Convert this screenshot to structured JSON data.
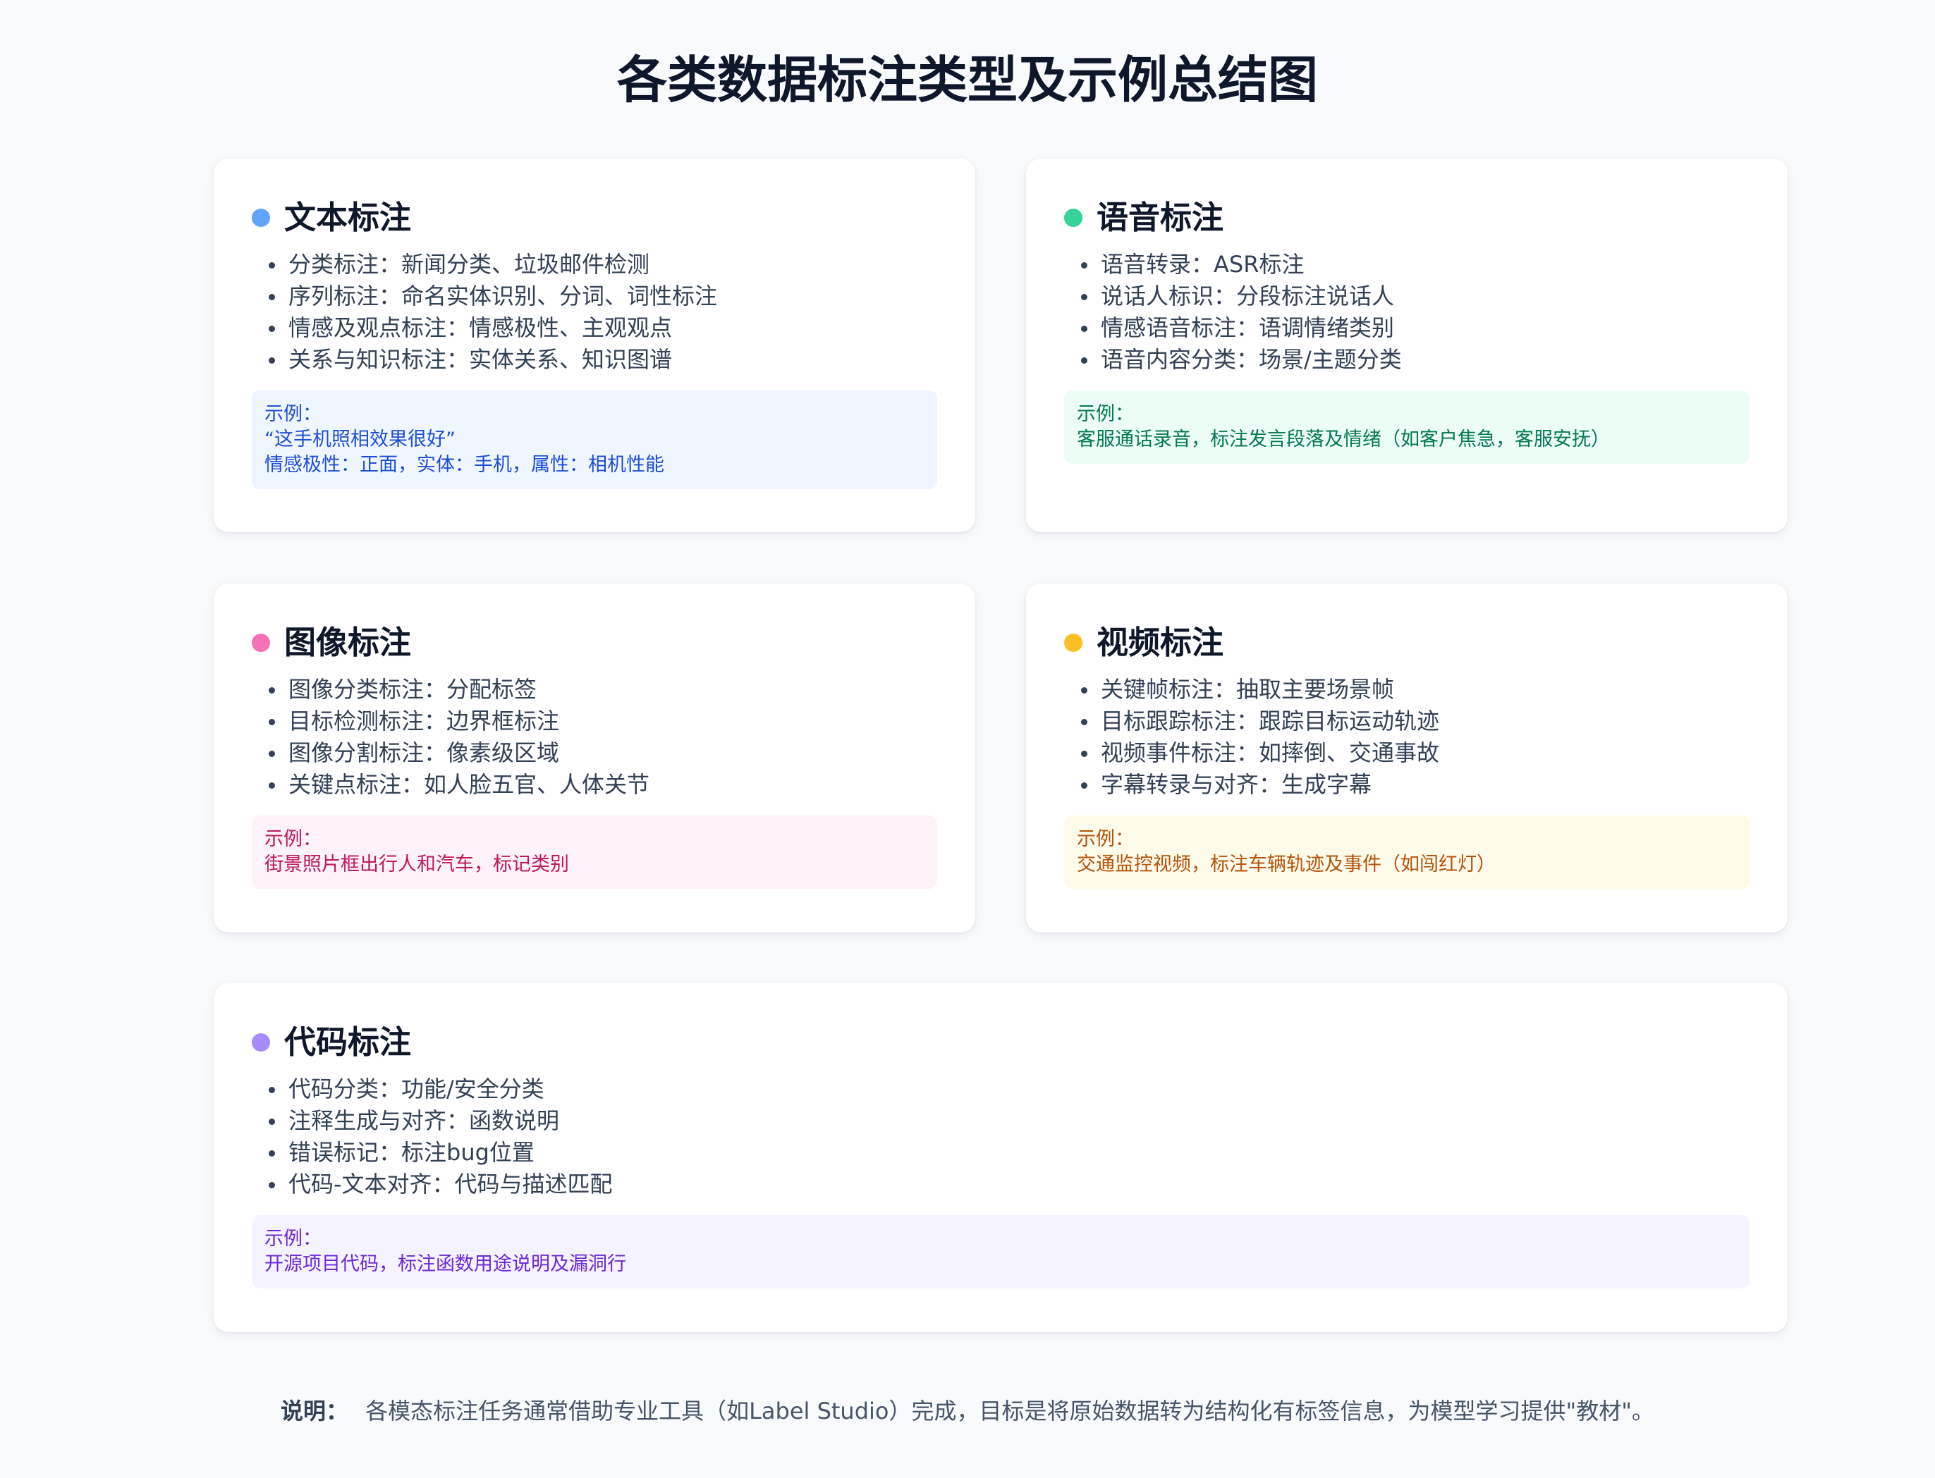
{
  "title": "各类数据标注类型及示例总结图",
  "cards": {
    "text": {
      "title": "文本标注",
      "dot_color": "#60a5fa",
      "items": [
        "分类标注：新闻分类、垃圾邮件检测",
        "序列标注：命名实体识别、分词、词性标注",
        "情感及观点标注：情感极性、主观观点",
        "关系与知识标注：实体关系、知识图谱"
      ],
      "example_bg": "#eff6ff",
      "example_color": "#1d4ed8",
      "example_lines": [
        "示例：",
        "“这手机照相效果很好”",
        "情感极性：正面，实体：手机，属性：相机性能"
      ]
    },
    "speech": {
      "title": "语音标注",
      "dot_color": "#34d399",
      "items": [
        "语音转录：ASR标注",
        "说话人标识：分段标注说话人",
        "情感语音标注：语调情绪类别",
        "语音内容分类：场景/主题分类"
      ],
      "example_bg": "#ecfdf5",
      "example_color": "#047857",
      "example_lines": [
        "示例：",
        "客服通话录音，标注发言段落及情绪（如客户焦急，客服安抚）"
      ]
    },
    "image": {
      "title": "图像标注",
      "dot_color": "#f472b6",
      "items": [
        "图像分类标注：分配标签",
        "目标检测标注：边界框标注",
        "图像分割标注：像素级区域",
        "关键点标注：如人脸五官、人体关节"
      ],
      "example_bg": "#fdf2f8",
      "example_color": "#be185d",
      "example_lines": [
        "示例：",
        "街景照片框出行人和汽车，标记类别"
      ]
    },
    "video": {
      "title": "视频标注",
      "dot_color": "#fbbf24",
      "items": [
        "关键帧标注：抽取主要场景帧",
        "目标跟踪标注：跟踪目标运动轨迹",
        "视频事件标注：如摔倒、交通事故",
        "字幕转录与对齐：生成字幕"
      ],
      "example_bg": "#fffbeb",
      "example_color": "#b45309",
      "example_lines": [
        "示例：",
        "交通监控视频，标注车辆轨迹及事件（如闯红灯）"
      ]
    },
    "code": {
      "title": "代码标注",
      "dot_color": "#a78bfa",
      "items": [
        "代码分类：功能/安全分类",
        "注释生成与对齐：函数说明",
        "错误标记：标注bug位置",
        "代码-文本对齐：代码与描述匹配"
      ],
      "example_bg": "#f5f3ff",
      "example_color": "#6d28d9",
      "example_lines": [
        "示例：",
        "开源项目代码，标注函数用途说明及漏洞行"
      ]
    }
  },
  "note": {
    "label": "说明：",
    "text": "各模态标注任务通常借助专业工具（如Label Studio）完成，目标是将原始数据转为结构化有标签信息，为模型学习提供\"教材\"。"
  }
}
